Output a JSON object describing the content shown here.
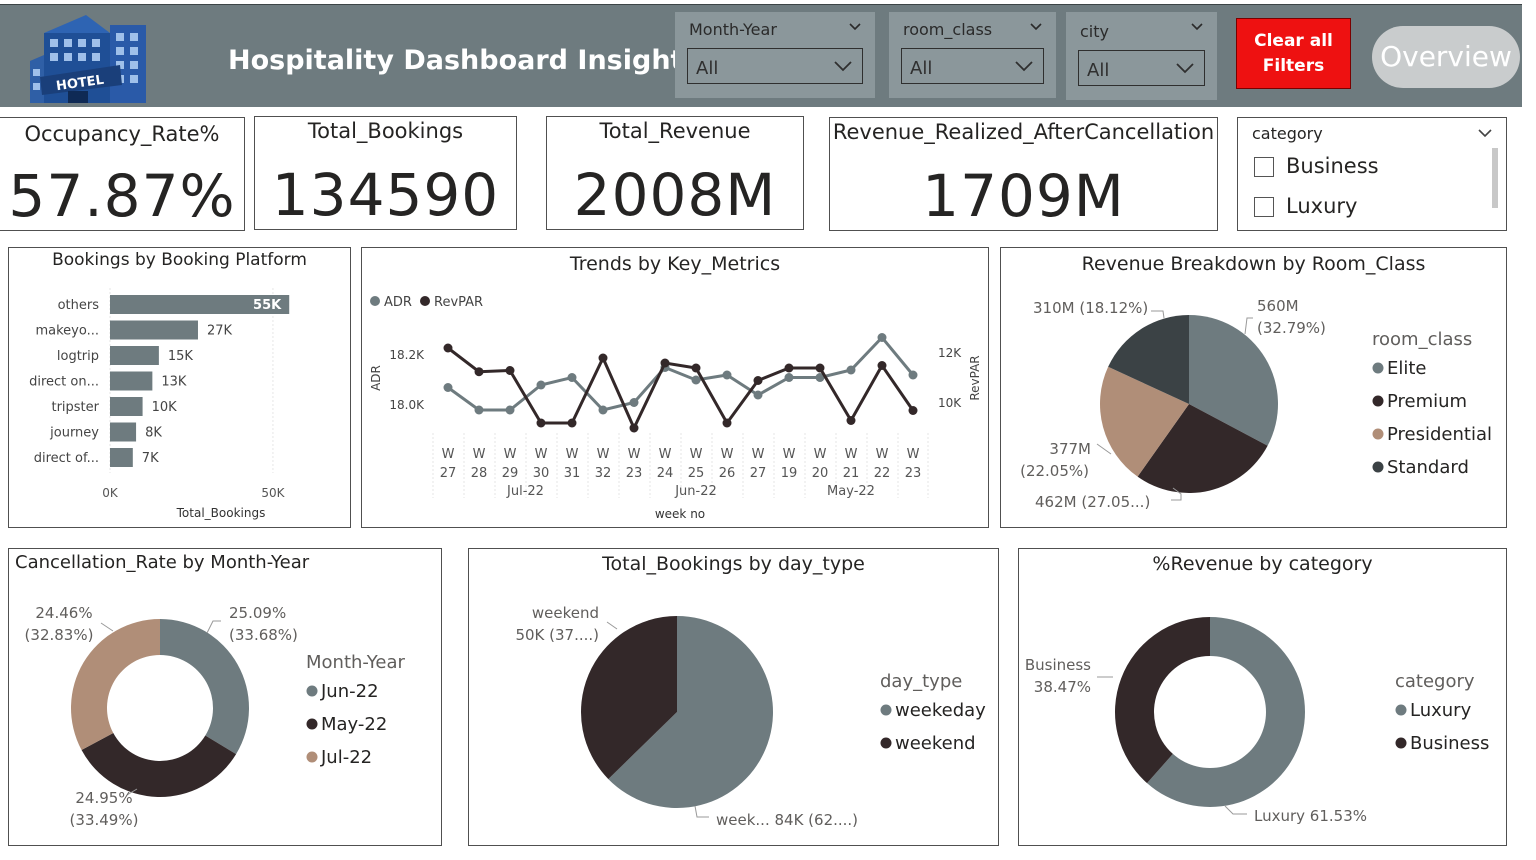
{
  "header": {
    "title": "Hospitality Dashboard Insights",
    "logo_text": "HOTEL",
    "slicers": [
      {
        "label": "Month-Year",
        "value": "All"
      },
      {
        "label": "room_class",
        "value": "All"
      },
      {
        "label": "city",
        "value": "All"
      }
    ],
    "clear_label_1": "Clear all",
    "clear_label_2": "Filters",
    "overview_label": "Overview"
  },
  "kpis": [
    {
      "title": "Occupancy_Rate%",
      "value": "57.87%"
    },
    {
      "title": "Total_Bookings",
      "value": "134590"
    },
    {
      "title": "Total_Revenue",
      "value": "2008M"
    },
    {
      "title": "Revenue_Realized_AfterCancellation",
      "value": "1709M"
    }
  ],
  "category_slicer": {
    "header": "category",
    "items": [
      "Business",
      "Luxury"
    ]
  },
  "colors": {
    "grey": "#6e7b7f",
    "dark": "#332829",
    "tan": "#b08e78",
    "charcoal": "#3b4245",
    "red": "#ee1111"
  },
  "chart_data": [
    {
      "type": "bar",
      "orientation": "horizontal",
      "title": "Bookings by Booking Platform",
      "categories": [
        "others",
        "makeyo...",
        "logtrip",
        "direct on...",
        "tripster",
        "journey",
        "direct of..."
      ],
      "values": [
        55,
        27,
        15,
        13,
        10,
        8,
        7
      ],
      "data_labels": [
        "55K",
        "27K",
        "15K",
        "13K",
        "10K",
        "8K",
        "7K"
      ],
      "xlabel": "Total_Bookings",
      "x_ticks": [
        "0K",
        "50K"
      ],
      "xlim": [
        0,
        58
      ]
    },
    {
      "type": "line",
      "title": "Trends by Key_Metrics",
      "xlabel": "week no",
      "ylabel_left": "ADR",
      "ylabel_right": "RevPAR",
      "y_ticks_left": [
        "18.2K",
        "18.0K"
      ],
      "y_ticks_right": [
        "12K",
        "10K"
      ],
      "x_week_letter": "W",
      "x_weeks": [
        "27",
        "28",
        "29",
        "30",
        "31",
        "32",
        "23",
        "24",
        "25",
        "26",
        "27",
        "19",
        "20",
        "21",
        "22",
        "23"
      ],
      "x_groups": [
        "Jul-22",
        "Jun-22",
        "May-22"
      ],
      "series": [
        {
          "name": "ADR",
          "values": [
            18.07,
            17.98,
            17.98,
            18.08,
            18.11,
            17.98,
            18.01,
            18.15,
            18.1,
            18.12,
            18.04,
            18.11,
            18.11,
            18.14,
            18.27,
            18.12
          ]
        },
        {
          "name": "RevPAR",
          "values": [
            12.2,
            11.25,
            11.3,
            9.2,
            9.2,
            11.8,
            9.0,
            11.6,
            11.4,
            9.2,
            10.9,
            11.4,
            11.4,
            9.3,
            11.5,
            9.7
          ]
        }
      ]
    },
    {
      "type": "pie",
      "title": "Revenue Breakdown by Room_Class",
      "legend_title": "room_class",
      "slices": [
        {
          "name": "Elite",
          "value": 560,
          "label1": "560M",
          "label2": "(32.79%)"
        },
        {
          "name": "Premium",
          "value": 462,
          "label1": "462M (27.05...)",
          "label2": ""
        },
        {
          "name": "Presidential",
          "value": 377,
          "label1": "377M",
          "label2": "(22.05%)"
        },
        {
          "name": "Standard",
          "value": 310,
          "label1": "310M (18.12%)",
          "label2": ""
        }
      ]
    },
    {
      "type": "pie",
      "subtype": "donut",
      "title": "Cancellation_Rate by Month-Year",
      "legend_title": "Month-Year",
      "slices": [
        {
          "name": "Jun-22",
          "value": 33.68,
          "label1": "25.09%",
          "label2": "(33.68%)"
        },
        {
          "name": "May-22",
          "value": 33.49,
          "label1": "24.95%",
          "label2": "(33.49%)"
        },
        {
          "name": "Jul-22",
          "value": 32.83,
          "label1": "24.46%",
          "label2": "(32.83%)"
        }
      ]
    },
    {
      "type": "pie",
      "title": "Total_Bookings by day_type",
      "legend_title": "day_type",
      "slices": [
        {
          "name": "weekeday",
          "value": 84,
          "label1": "week... 84K (62....)",
          "label2": ""
        },
        {
          "name": "weekend",
          "value": 50,
          "label1": "weekend",
          "label2": "50K (37....)"
        }
      ]
    },
    {
      "type": "pie",
      "subtype": "donut",
      "title": "%Revenue by category",
      "legend_title": "category",
      "slices": [
        {
          "name": "Luxury",
          "value": 61.53,
          "label1": "Luxury 61.53%",
          "label2": ""
        },
        {
          "name": "Business",
          "value": 38.47,
          "label1": "Business",
          "label2": "38.47%"
        }
      ]
    }
  ]
}
